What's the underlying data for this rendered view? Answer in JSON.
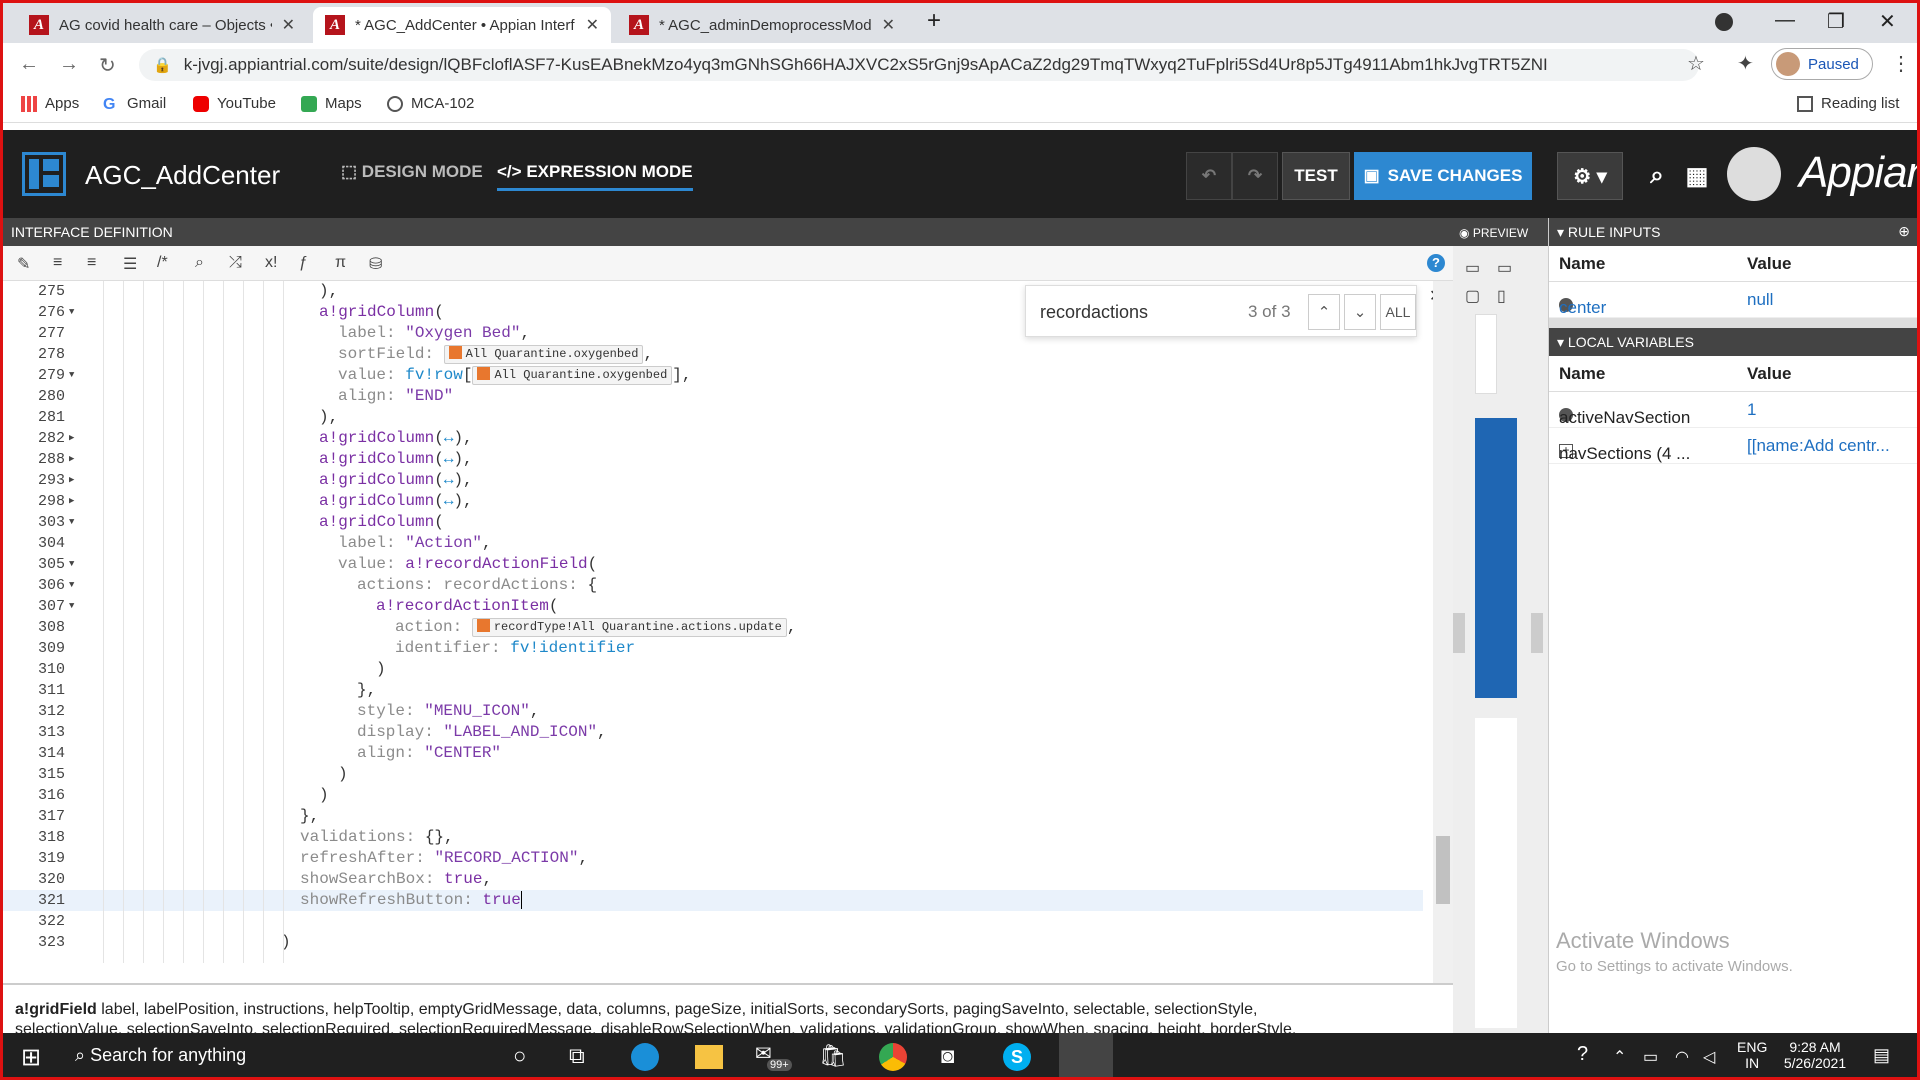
{
  "browser": {
    "tabs": [
      {
        "title": "AG covid health care – Objects •",
        "active": false
      },
      {
        "title": "* AGC_AddCenter • Appian Interf",
        "active": true
      },
      {
        "title": "* AGC_adminDemoprocessMode",
        "active": false
      }
    ],
    "url": "k-jvgj.appiantrial.com/suite/design/lQBFcloflASF7-KusEABnekMzo4yq3mGNhSGh66HAJXVC2xS5rGnj9sApACaZ2dg29TmqTWxyq2TuFplri5Sd4Ur8p5JTg4911Abm1hkJvgTRT5ZNI",
    "profile_label": "Paused",
    "bookmarks": [
      "Apps",
      "Gmail",
      "YouTube",
      "Maps",
      "MCA-102"
    ],
    "reading_list": "Reading list"
  },
  "app": {
    "title": "AGC_AddCenter",
    "design_mode": "DESIGN MODE",
    "expression_mode": "EXPRESSION MODE",
    "test_label": "TEST",
    "save_label": "SAVE CHANGES",
    "brand": "Appian",
    "accent": "#2d88d1"
  },
  "editor": {
    "header": "INTERFACE DEFINITION",
    "find": {
      "query": "recordactions",
      "count": "3 of 3",
      "all_label": "ALL"
    },
    "hint_fn": "a!gridField",
    "hint_line1": "label, labelPosition, instructions, helpTooltip, emptyGridMessage, data, columns, pageSize, initialSorts, secondarySorts, pagingSaveInto, selectable, selectionStyle,",
    "hint_line2": "selectionValue, selectionSaveInto, selectionRequired, selectionRequiredMessage, disableRowSelectionWhen, validations, validationGroup, showWhen, spacing, height, borderStyle,"
  },
  "preview": {
    "label": "PREVIEW"
  },
  "rule_inputs": {
    "header": "RULE INPUTS",
    "col_name": "Name",
    "col_value": "Value",
    "rows": [
      {
        "name": "center",
        "value": "null"
      }
    ]
  },
  "local_vars": {
    "header": "LOCAL VARIABLES",
    "col_name": "Name",
    "col_value": "Value",
    "rows": [
      {
        "name": "activeNavSection",
        "value": "1"
      },
      {
        "name": "navSections (4 ...",
        "value": "[[name:Add centr..."
      }
    ]
  },
  "watermark": {
    "line1": "Activate Windows",
    "line2": "Go to Settings to activate Windows."
  },
  "taskbar": {
    "search_placeholder": "Search for anything",
    "mail_badge": "99+",
    "lang1": "ENG",
    "lang2": "IN",
    "time": "9:28 AM",
    "date": "5/26/2021"
  }
}
